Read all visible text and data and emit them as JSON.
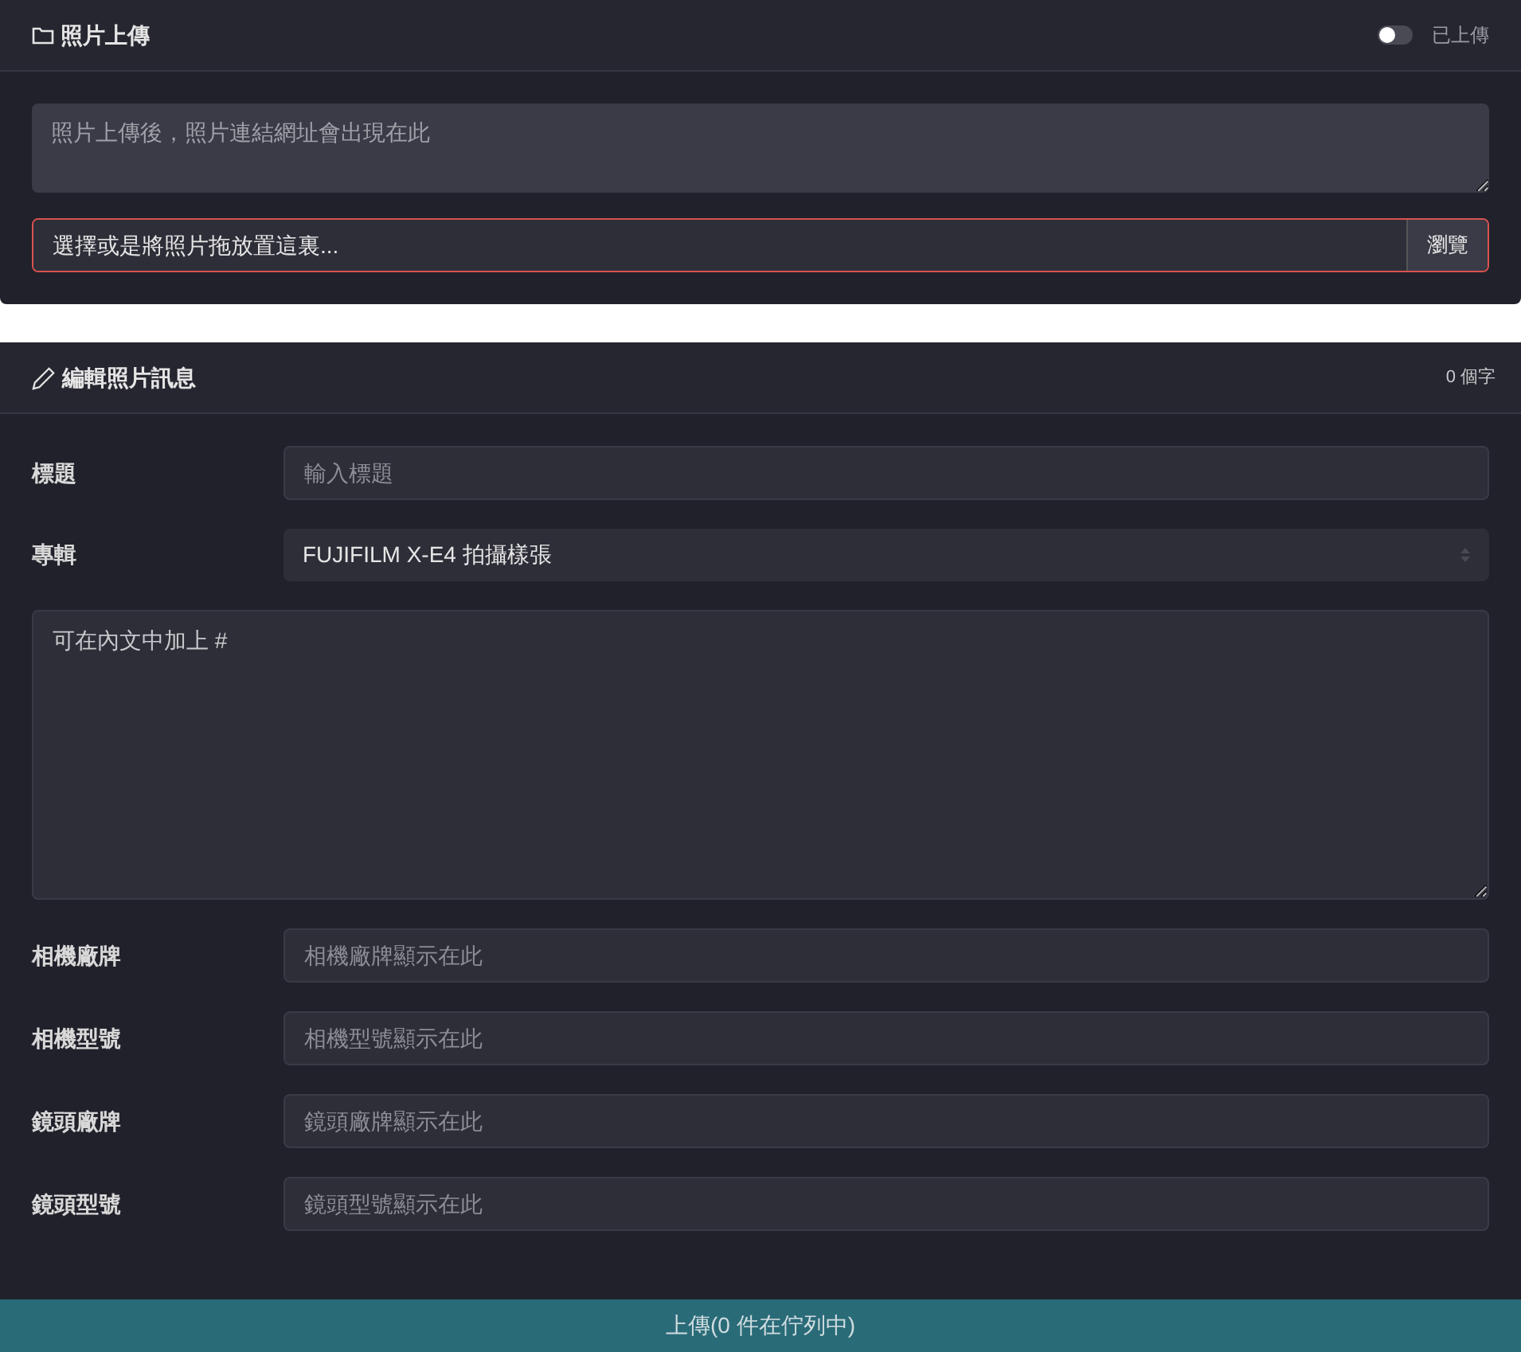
{
  "upload_card": {
    "title": "照片上傳",
    "toggle": {
      "label": "已上傳",
      "on": false
    },
    "url_box": {
      "placeholder": "照片上傳後，照片連結網址會出現在此"
    },
    "file_picker": {
      "placeholder": "選擇或是將照片拖放置這裏...",
      "button": "瀏覽",
      "invalid": true
    }
  },
  "edit_card": {
    "title": "編輯照片訊息",
    "char_count": "0 個字",
    "title_field": {
      "label": "標題",
      "placeholder": "輸入標題"
    },
    "album": {
      "label": "專輯",
      "value": "FUJIFILM X-E4 拍攝樣張"
    },
    "body": {
      "placeholder": "可在內文中加上 #"
    },
    "details": [
      {
        "label": "相機廠牌",
        "placeholder": "相機廠牌顯示在此"
      },
      {
        "label": "相機型號",
        "placeholder": "相機型號顯示在此"
      },
      {
        "label": "鏡頭廠牌",
        "placeholder": "鏡頭廠牌顯示在此"
      },
      {
        "label": "鏡頭型號",
        "placeholder": "鏡頭型號顯示在此"
      }
    ]
  },
  "upload_button": "上傳(0 件在佇列中)"
}
